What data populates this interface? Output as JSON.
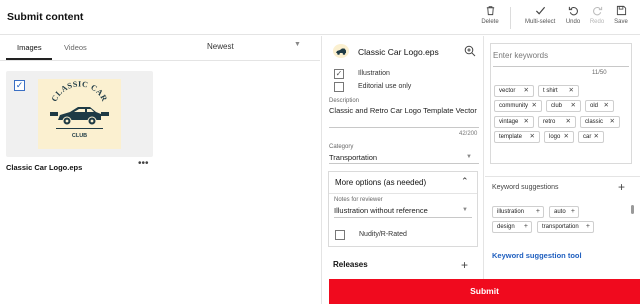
{
  "header": {
    "title": "Submit content"
  },
  "toolbar": {
    "delete": "Delete",
    "multiselect": "Multi-select",
    "undo": "Undo",
    "redo": "Redo",
    "save": "Save"
  },
  "tabs": [
    {
      "label": "Images",
      "active": true
    },
    {
      "label": "Videos",
      "active": false
    }
  ],
  "sort": {
    "value": "Newest"
  },
  "gallery": [
    {
      "filename": "Classic Car Logo.eps",
      "selected": true
    }
  ],
  "thumbnail": {
    "title_text": "CLASSIC CAR",
    "sub_text": "CLUB"
  },
  "detail": {
    "filename": "Classic Car Logo.eps",
    "illustration_label": "Illustration",
    "illustration_checked": true,
    "editorial_label": "Editorial use only",
    "editorial_checked": false,
    "description_label": "Description",
    "description_value": "Classic and Retro Car Logo Template Vector",
    "description_count": "42/200",
    "category_label": "Category",
    "category_value": "Transportation",
    "more_options_label": "More options (as needed)",
    "notes_label": "Notes for reviewer",
    "notes_value": "Illustration without reference",
    "nudity_label": "Nudity/R-Rated",
    "nudity_checked": false,
    "releases_label": "Releases"
  },
  "keywords": {
    "placeholder": "Enter keywords",
    "count": "11/50",
    "items": [
      "vector",
      "t shirt",
      "community",
      "club",
      "old",
      "vintage",
      "retro",
      "classic",
      "template",
      "logo",
      "car"
    ]
  },
  "suggestions": {
    "title": "Keyword suggestions",
    "items": [
      "illustration",
      "auto",
      "design",
      "transportation"
    ],
    "link": "Keyword suggestion tool"
  },
  "submit": {
    "label": "Submit"
  },
  "colors": {
    "submit_bg": "#f00a1e",
    "link": "#1f5fbf",
    "thumb_bg": "#fbf0d0",
    "thumb_ink": "#1e3a45"
  }
}
